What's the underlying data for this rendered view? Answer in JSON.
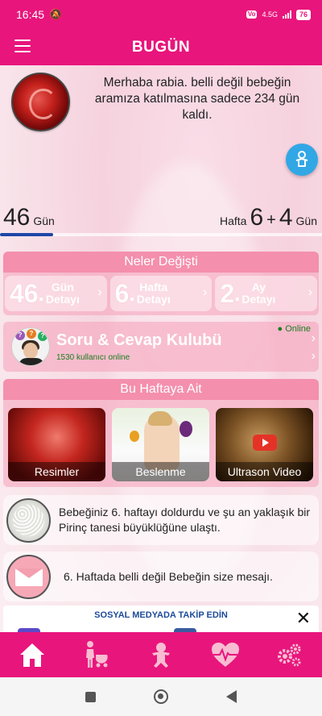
{
  "status_bar": {
    "time": "16:45",
    "network": "4.5G",
    "battery": "76"
  },
  "app_bar": {
    "title": "BUGÜN"
  },
  "hero": {
    "greeting": "Merhaba rabia. belli değil  bebeğin aramıza katılmasına sadece 234 gün kaldı.",
    "days_value": "46",
    "days_unit": "Gün",
    "week_label": "Hafta",
    "week_value": "6",
    "plus": "+",
    "extra_days": "4",
    "extra_days_unit": "Gün",
    "progress_fraction": 0.164
  },
  "changes": {
    "title": "Neler Değişti",
    "items": [
      {
        "number": "46",
        "dot": ".",
        "line1": "Gün",
        "line2": "Detayı"
      },
      {
        "number": "6",
        "dot": ".",
        "line1": "Hafta",
        "line2": "Detayı"
      },
      {
        "number": "2",
        "dot": ".",
        "line1": "Ay",
        "line2": "Detayı"
      }
    ]
  },
  "club": {
    "title": "Soru & Cevap Kulubü",
    "subtitle": "1530 kullanıcı online",
    "online": "● Online"
  },
  "this_week": {
    "title": "Bu Haftaya Ait",
    "tiles": [
      {
        "caption": "Resimler"
      },
      {
        "caption": "Beslenme"
      },
      {
        "caption": "Ultrason Video"
      }
    ]
  },
  "info_rows": [
    {
      "text": "Bebeğiniz 6. haftayı doldurdu ve şu an yaklaşık bir Pirinç tanesi büyüklüğüne ulaştı."
    },
    {
      "text": "6. Haftada belli değil  Bebeğin size mesajı."
    }
  ],
  "social": {
    "title": "SOSYAL MEDYADA TAKİP EDİN",
    "close": "✕"
  },
  "colors": {
    "primary": "#e8157c",
    "card": "#f48fad",
    "fab": "#32a7e6",
    "progress": "#1e46a8"
  },
  "bottom_nav": [
    "home-icon",
    "mother-stroller-icon",
    "baby-icon",
    "heart-pulse-icon",
    "gears-icon"
  ]
}
